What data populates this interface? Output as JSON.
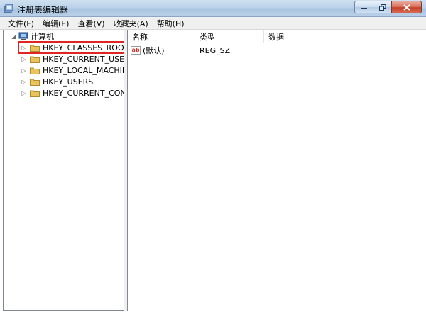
{
  "window": {
    "title": "注册表编辑器",
    "controls": {
      "minimize": "minimize",
      "maximize": "maximize",
      "close": "close"
    }
  },
  "menu": [
    "文件(F)",
    "编辑(E)",
    "查看(V)",
    "收藏夹(A)",
    "帮助(H)"
  ],
  "tree": {
    "root_label": "计算机",
    "keys": [
      "HKEY_CLASSES_ROOT",
      "HKEY_CURRENT_USER",
      "HKEY_LOCAL_MACHINE",
      "HKEY_USERS",
      "HKEY_CURRENT_CONFIG"
    ],
    "selected_index": 0,
    "highlight_color": "#e02424"
  },
  "list": {
    "columns": [
      "名称",
      "类型",
      "数据"
    ],
    "rows": [
      {
        "name": "(默认)",
        "type": "REG_SZ",
        "data": ""
      }
    ]
  },
  "colors": {
    "titlebar": "#bcd3ea",
    "folder": "#e8c45f",
    "menubar": "#f0f0f0"
  }
}
